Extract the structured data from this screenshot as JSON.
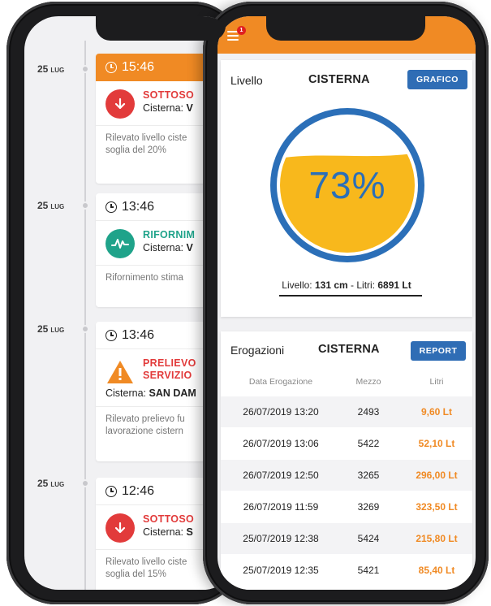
{
  "colors": {
    "topbar": "#f08a24",
    "accent_blue": "#2f6db5",
    "gauge_fill": "#f8b81c",
    "gauge_ring": "#2b6fb8",
    "alert_red": "#e23b3b",
    "refill_green": "#1fa38a",
    "liters_orange": "#f08a24"
  },
  "timeline": {
    "entries": [
      {
        "date_day": "25",
        "date_month": "LUG",
        "time": "15:46",
        "highlighted": true,
        "icon": "arrow-down-icon",
        "title": "SOTTOSO",
        "subtitle_label": "Cisterna:",
        "subtitle_value": "V",
        "description_line1": "Rilevato livello ciste",
        "description_line2": "soglia del 20%"
      },
      {
        "date_day": "25",
        "date_month": "LUG",
        "time": "13:46",
        "highlighted": false,
        "icon": "pulse-wave-icon",
        "title": "RIFORNIM",
        "subtitle_label": "Cisterna:",
        "subtitle_value": "V",
        "description_line1": "Rifornimento stima",
        "description_line2": ""
      },
      {
        "date_day": "25",
        "date_month": "LUG",
        "time": "13:46",
        "highlighted": false,
        "icon": "warning-triangle-icon",
        "title_line1": "PRELIEVO",
        "title_line2": "SERVIZIO",
        "subtitle_label": "Cisterna:",
        "subtitle_value": "SAN DAM",
        "description_line1": "Rilevato prelievo fu",
        "description_line2": "lavorazione cistern"
      },
      {
        "date_day": "25",
        "date_month": "LUG",
        "time": "12:46",
        "highlighted": false,
        "icon": "arrow-down-icon",
        "title": "SOTTOSO",
        "subtitle_label": "Cisterna:",
        "subtitle_value": "S",
        "description_line1": "Rilevato livello ciste",
        "description_line2": "soglia del 15%"
      }
    ]
  },
  "app": {
    "notification_count": "1",
    "level_panel": {
      "label": "Livello",
      "title": "CISTERNA",
      "button": "GRAFICO",
      "percent_text": "73%",
      "fill_fraction": 0.73,
      "caption_level_label": "Livello:",
      "caption_level_value": "131 cm",
      "caption_sep": "-",
      "caption_liters_label": "Litri:",
      "caption_liters_value": "6891 Lt"
    },
    "dispensing_panel": {
      "label": "Erogazioni",
      "title": "CISTERNA",
      "button": "REPORT",
      "columns": [
        "Data Erogazione",
        "Mezzo",
        "Litri"
      ],
      "rows": [
        [
          "26/07/2019 13:20",
          "2493",
          "9,60 Lt"
        ],
        [
          "26/07/2019 13:06",
          "5422",
          "52,10 Lt"
        ],
        [
          "26/07/2019 12:50",
          "3265",
          "296,00 Lt"
        ],
        [
          "26/07/2019 11:59",
          "3269",
          "323,50 Lt"
        ],
        [
          "25/07/2019 12:38",
          "5424",
          "215,80 Lt"
        ],
        [
          "25/07/2019 12:35",
          "5421",
          "85,40 Lt"
        ]
      ]
    }
  }
}
